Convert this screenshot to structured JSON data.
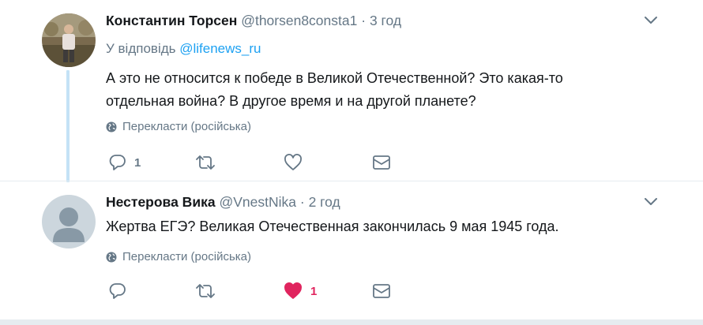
{
  "tweets": [
    {
      "name": "Константин Торсен",
      "handle": "@thorsen8consta1",
      "separator": "·",
      "time": "3 год",
      "reply_prefix": "У відповідь",
      "reply_to": "@lifenews_ru",
      "text_line1": "А это не относится к победе в Великой Отечественной? Это какая-то",
      "text_line2": "отдельная война? В другое время и на другой планете?",
      "translate_label": "Перекласти (російська)",
      "actions": {
        "reply_count": "1",
        "retweet_count": "",
        "like_count": ""
      },
      "icons": [
        "avatar-photo",
        "chevron-down-icon",
        "globe-icon",
        "reply-icon",
        "retweet-icon",
        "heart-icon",
        "dm-icon"
      ]
    },
    {
      "name": "Нестерова Вика",
      "handle": "@VnestNika",
      "separator": "·",
      "time": "2 год",
      "text": "Жертва ЕГЭ? Великая Отечественная закончилась 9 мая 1945 года.",
      "translate_label": "Перекласти (російська)",
      "actions": {
        "reply_count": "",
        "retweet_count": "",
        "like_count": "1",
        "liked": true
      },
      "icons": [
        "default-avatar-icon",
        "chevron-down-icon",
        "globe-icon",
        "reply-icon",
        "retweet-icon",
        "heart-filled-icon",
        "dm-icon"
      ]
    }
  ],
  "colors": {
    "text": "#14171a",
    "muted": "#657786",
    "link": "#1da1f2",
    "like": "#e0245e",
    "thread_line": "#c4e2f6",
    "divider": "#e6ecf0"
  }
}
